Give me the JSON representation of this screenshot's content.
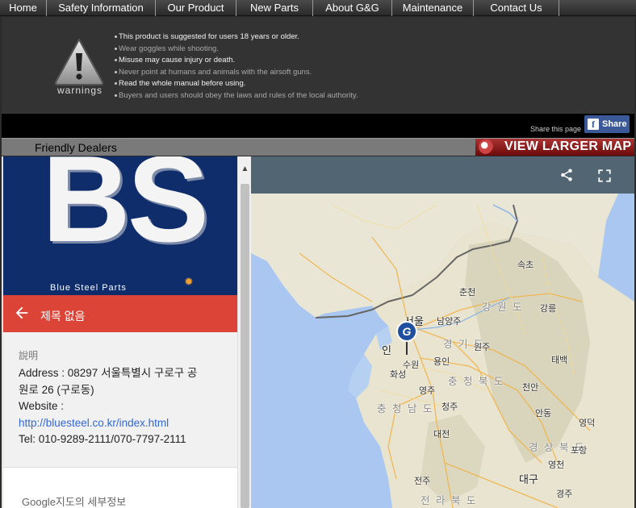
{
  "nav": {
    "items": [
      "Home",
      "Safety Information",
      "Our Product",
      "New Parts",
      "About G&G",
      "Maintenance",
      "Contact Us"
    ]
  },
  "warnings": {
    "label": "warnings",
    "items": [
      {
        "text": "This product is suggested for users 18 years or older.",
        "color": "#f2f2f2"
      },
      {
        "text": "Wear goggles while shooting.",
        "color": "#a8a8a8"
      },
      {
        "text": "Misuse may cause injury or death.",
        "color": "#f2f2f2"
      },
      {
        "text": "Never point at humans and animals with the airsoft guns.",
        "color": "#a8a8a8"
      },
      {
        "text": "Read the whole manual before using.",
        "color": "#f2f2f2"
      },
      {
        "text": "Buyers and users should obey the laws and rules of the local authority.",
        "color": "#a8a8a8"
      }
    ]
  },
  "share": {
    "text": "Share this page",
    "button_label": "Share",
    "button_icon": "f"
  },
  "dealers": {
    "title": "Friendly Dealers",
    "view_larger_map": "VIEW LARGER MAP"
  },
  "place_panel": {
    "logo_text": "BS",
    "logo_subtitle": "Blue Steel Parts",
    "title": "제목 없음",
    "detail_label": "說明",
    "address_line1": "Address : 08297 서울특별시 구로구 공",
    "address_line2": "원로 26 (구로동)",
    "website_label": "Website :",
    "website_url": "http://bluesteel.co.kr/index.html",
    "tel": "Tel: 010-9289-2111/070-7797-2111",
    "google_details": "Google지도의 세부정보"
  },
  "map": {
    "marker_letter": "G",
    "places": [
      {
        "text": "속초",
        "cls": "place"
      },
      {
        "text": "춘천",
        "cls": "place"
      },
      {
        "text": "강 원 도",
        "cls": "place prov"
      },
      {
        "text": "강릉",
        "cls": "place"
      },
      {
        "text": "서울",
        "cls": "place big"
      },
      {
        "text": "남양주",
        "cls": "place"
      },
      {
        "text": "경 기 도",
        "cls": "place prov"
      },
      {
        "text": "원주",
        "cls": "place"
      },
      {
        "text": "인",
        "cls": "place big"
      },
      {
        "text": "수원",
        "cls": "place"
      },
      {
        "text": "용인",
        "cls": "place"
      },
      {
        "text": "태백",
        "cls": "place"
      },
      {
        "text": "화성",
        "cls": "place"
      },
      {
        "text": "충 청 북 도",
        "cls": "place prov"
      },
      {
        "text": "천안",
        "cls": "place"
      },
      {
        "text": "영주",
        "cls": "place"
      },
      {
        "text": "충 청 남 도",
        "cls": "place prov"
      },
      {
        "text": "청주",
        "cls": "place"
      },
      {
        "text": "안동",
        "cls": "place"
      },
      {
        "text": "영덕",
        "cls": "place"
      },
      {
        "text": "대전",
        "cls": "place"
      },
      {
        "text": "경 상 북 도",
        "cls": "place prov"
      },
      {
        "text": "포항",
        "cls": "place"
      },
      {
        "text": "영천",
        "cls": "place"
      },
      {
        "text": "전주",
        "cls": "place"
      },
      {
        "text": "대구",
        "cls": "place big"
      },
      {
        "text": "전 라 북 도",
        "cls": "place prov"
      },
      {
        "text": "경주",
        "cls": "place"
      }
    ]
  }
}
